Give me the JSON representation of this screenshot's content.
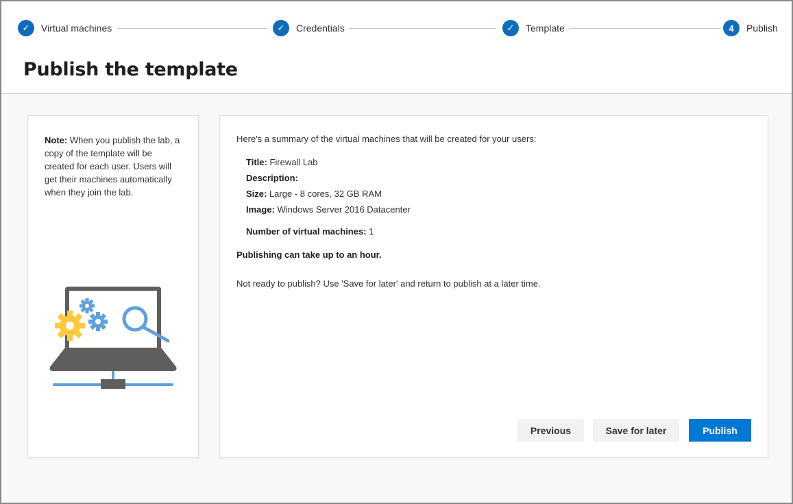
{
  "stepper": {
    "steps": [
      {
        "label": "Virtual machines",
        "status": "complete",
        "marker": "✓"
      },
      {
        "label": "Credentials",
        "status": "complete",
        "marker": "✓"
      },
      {
        "label": "Template",
        "status": "complete",
        "marker": "✓"
      },
      {
        "label": "Publish",
        "status": "current",
        "marker": "4"
      }
    ]
  },
  "page": {
    "title": "Publish the template"
  },
  "note": {
    "label": "Note:",
    "text": " When you publish the lab, a copy of the template will be created for each user. Users will get their machines automatically when they join the lab.",
    "illustration_icon": "laptop-gears-search-icon"
  },
  "summary": {
    "intro": "Here's a summary of the virtual machines that will be created for your users:",
    "details": [
      {
        "label": "Title:",
        "value": " Firewall Lab"
      },
      {
        "label": "Description:",
        "value": ""
      },
      {
        "label": "Size:",
        "value": " Large - 8 cores, 32 GB RAM"
      },
      {
        "label": "Image:",
        "value": " Windows Server 2016 Datacenter"
      }
    ],
    "vm_count_label": "Number of virtual machines:",
    "vm_count_value": " 1",
    "warning": "Publishing can take up to an hour.",
    "later_note": "Not ready to publish? Use 'Save for later' and return to publish at a later time."
  },
  "buttons": {
    "previous": "Previous",
    "save_for_later": "Save for later",
    "publish": "Publish"
  },
  "colors": {
    "accent": "#0078d4",
    "step_circle": "#0f6cbd",
    "gear_yellow": "#ffc83d",
    "gear_blue": "#5ea0e0",
    "laptop_gray": "#605e5c"
  }
}
